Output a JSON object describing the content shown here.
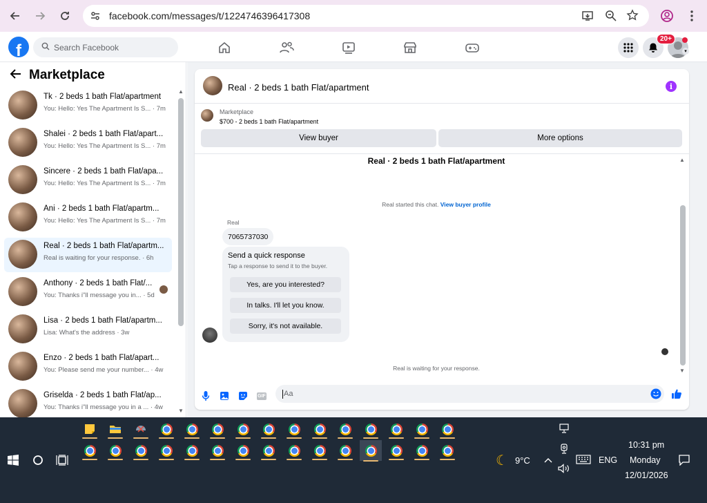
{
  "browser": {
    "url": "facebook.com/messages/t/1224746396417308"
  },
  "header": {
    "logo": "f",
    "search_placeholder": "Search Facebook",
    "notification_count": "20+"
  },
  "sidebar": {
    "title": "Marketplace",
    "conversations": [
      {
        "name": "Tk · 2 beds 1 bath Flat/apartment",
        "snippet": "You: Hello: Yes The Apartment Is S... · 7m"
      },
      {
        "name": "Shalei · 2 beds 1 bath Flat/apart...",
        "snippet": "You: Hello: Yes The Apartment Is S... · 7m"
      },
      {
        "name": "Sincere · 2 beds 1 bath Flat/apa...",
        "snippet": "You: Hello: Yes The Apartment Is S... · 7m"
      },
      {
        "name": "Ani · 2 beds 1 bath Flat/apartm...",
        "snippet": "You: Hello: Yes The Apartment Is S... · 7m"
      },
      {
        "name": "Real · 2 beds 1 bath Flat/apartm...",
        "snippet": "Real is waiting for your response. · 6h"
      },
      {
        "name": "Anthony · 2 beds 1 bath Flat/...",
        "snippet": "You: Thanks i\"ll message you in... · 5d"
      },
      {
        "name": "Lisa · 2 beds 1 bath Flat/apartm...",
        "snippet": "Lisa: What's the address · 3w"
      },
      {
        "name": "Enzo · 2 beds 1 bath Flat/apart...",
        "snippet": "You: Please send me your number... · 4w"
      },
      {
        "name": "Griselda · 2 beds 1 bath Flat/ap...",
        "snippet": "You: Thanks i\"ll message you in a ... · 4w"
      }
    ]
  },
  "chat": {
    "title": "Real · 2 beds 1 bath Flat/apartment",
    "marketplace_label": "Marketplace",
    "listing": "$700 - 2 beds 1 bath Flat/apartment",
    "view_buyer": "View buyer",
    "more_options": "More options",
    "thread_title": "Real · 2 beds 1 bath Flat/apartment",
    "started_text": "Real started this chat.",
    "started_link": "View buyer profile",
    "sender_name": "Real",
    "phone_message": "7065737030",
    "quick_title": "Send a quick response",
    "quick_sub": "Tap a response to send it to the buyer.",
    "quick_responses": [
      "Yes, are you interested?",
      "In talks. I'll let you know.",
      "Sorry, it's not available."
    ],
    "waiting": "Real is waiting for your response.",
    "composer_placeholder": "Aa",
    "gif_label": "GIF"
  },
  "taskbar": {
    "temperature": "9°C",
    "language": "ENG",
    "time": "10:31 pm",
    "day": "Monday",
    "date": "12/01/2026"
  }
}
